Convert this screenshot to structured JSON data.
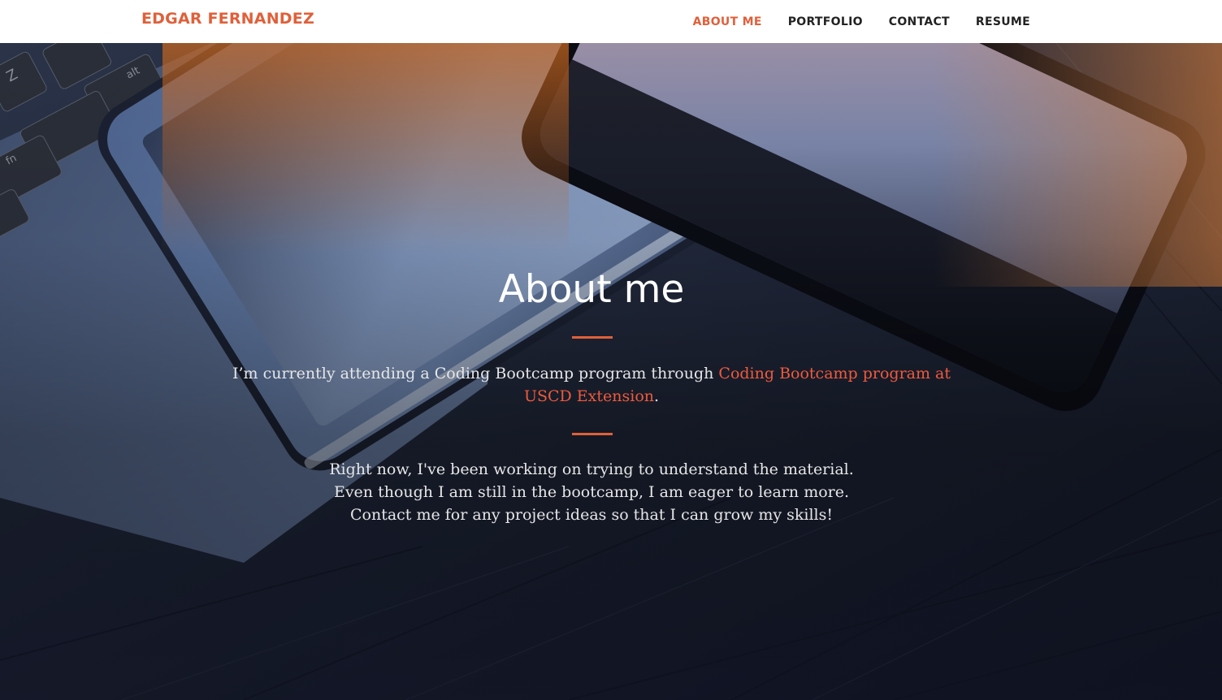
{
  "navbar": {
    "brand": "EDGAR FERNANDEZ",
    "links": [
      "ABOUT ME",
      "PORTFOLIO",
      "CONTACT",
      "RESUME"
    ],
    "active_index": 0
  },
  "hero": {
    "title": "About me",
    "intro_text": "I’m currently attending a Coding Bootcamp program through ",
    "intro_link": "Coding Bootcamp program at USCD Extension",
    "intro_end": ".",
    "body_lines": [
      "Right now, I've been working on trying to understand the material.",
      "Even though I am still in the bootcamp, I am eager to learn more.",
      "Contact me for any project ideas so that I can grow my skills!"
    ]
  },
  "colors": {
    "accent": "#e0603a",
    "link": "#f05a3c",
    "nav_text": "#222222",
    "hero_text": "#e6e6e6"
  }
}
